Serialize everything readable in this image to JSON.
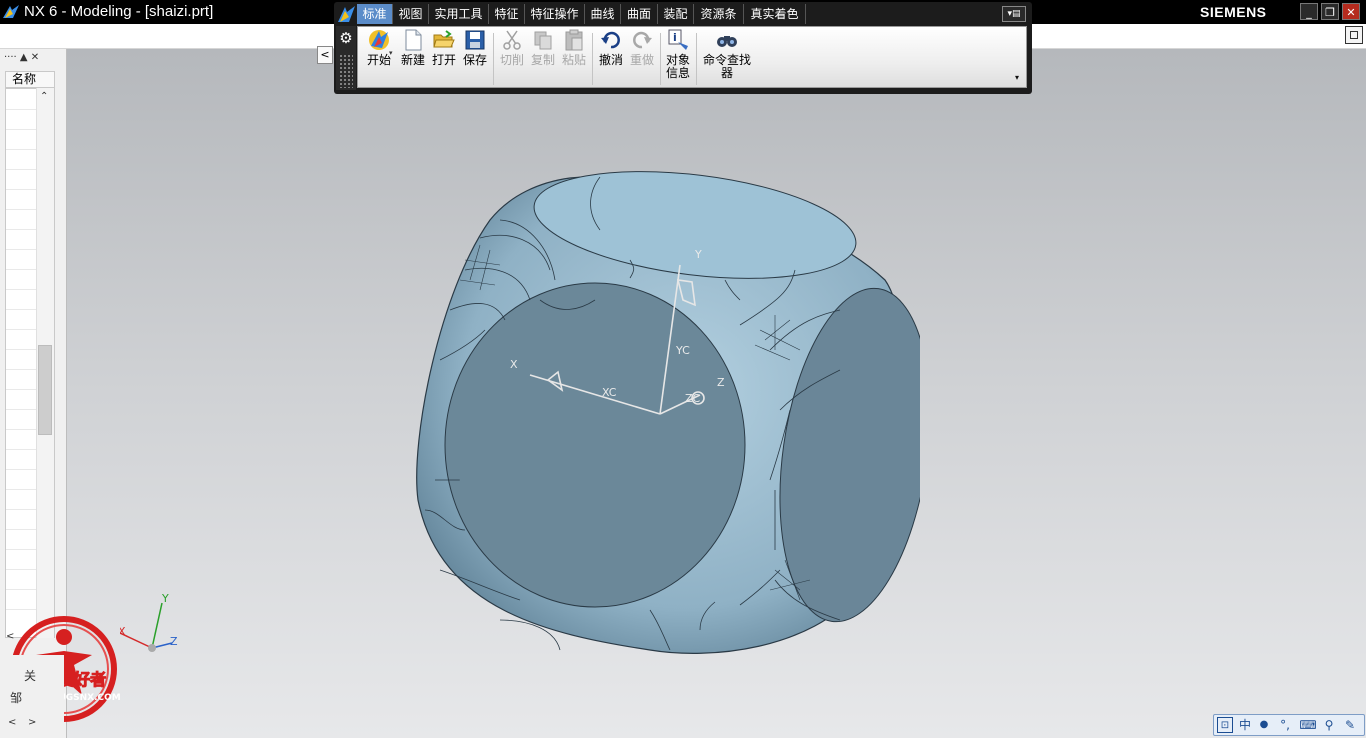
{
  "window": {
    "title": "NX 6 - Modeling - [shaizi.prt]",
    "brand": "SIEMENS",
    "controls": [
      "_",
      "❐",
      "✕"
    ]
  },
  "toolbar": {
    "tabs": [
      "标准",
      "视图",
      "实用工具",
      "特征",
      "特征操作",
      "曲线",
      "曲面",
      "装配",
      "资源条",
      "真实着色"
    ],
    "active_tab": "标准",
    "buttons": {
      "start": "开始",
      "new": "新建",
      "open": "打开",
      "save": "保存",
      "cut": "切削",
      "copy": "复制",
      "paste": "粘贴",
      "undo": "撤消",
      "redo": "重做",
      "object_info_1": "对象",
      "object_info_2": "信息",
      "command_finder_1": "命令查找",
      "command_finder_2": "器"
    },
    "more_glyph": "▾"
  },
  "navigator": {
    "column_header": "名称",
    "header_glyphs": "···· ▲ ✕",
    "bottom_tab1": "关",
    "bottom_tab2": "邹",
    "scroll_left": "<",
    "scroll_right": ">"
  },
  "viewport": {
    "side_toggle": "<",
    "csys_labels": {
      "x": "X",
      "xc": "XC",
      "y": "Y",
      "yc": "YC",
      "z": "Z",
      "zc": "ZC"
    },
    "triad_labels": {
      "x": "X",
      "y": "Y",
      "z": "Z"
    }
  },
  "watermark": {
    "text": "UG爱好者",
    "url": "WWW.UGSNX.COM"
  },
  "tray": {
    "items": [
      "中",
      "●",
      "°,",
      "⌨",
      "⚲",
      "✎"
    ]
  },
  "colors": {
    "titlebar": "#000000",
    "active_tab": "#5b8cc9",
    "dice_face": "#6a8698",
    "dice_body": "#9cbdd0",
    "watermark_red": "#d62020"
  }
}
